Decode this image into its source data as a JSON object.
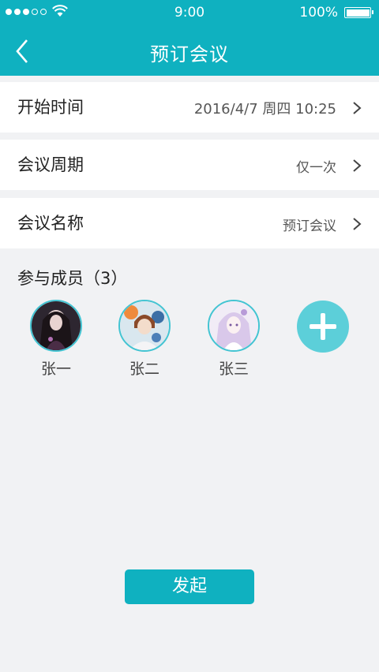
{
  "status_bar": {
    "time": "9:00",
    "battery": "100%"
  },
  "nav": {
    "title": "预订会议",
    "back_icon": "chevron-left-icon"
  },
  "form": {
    "rows": [
      {
        "label": "开始时间",
        "value": "2016/4/7 周四 10:25"
      },
      {
        "label": "会议周期",
        "value": "仅一次"
      },
      {
        "label": "会议名称",
        "value": "预订会议"
      }
    ]
  },
  "members": {
    "title": "参与成员（3）",
    "list": [
      {
        "name": "张一"
      },
      {
        "name": "张二"
      },
      {
        "name": "张三"
      }
    ],
    "add_icon": "plus-icon"
  },
  "submit_label": "发起",
  "colors": {
    "primary": "#0fb1c0",
    "add_button": "#5ccfd9",
    "background": "#f1f2f4"
  }
}
